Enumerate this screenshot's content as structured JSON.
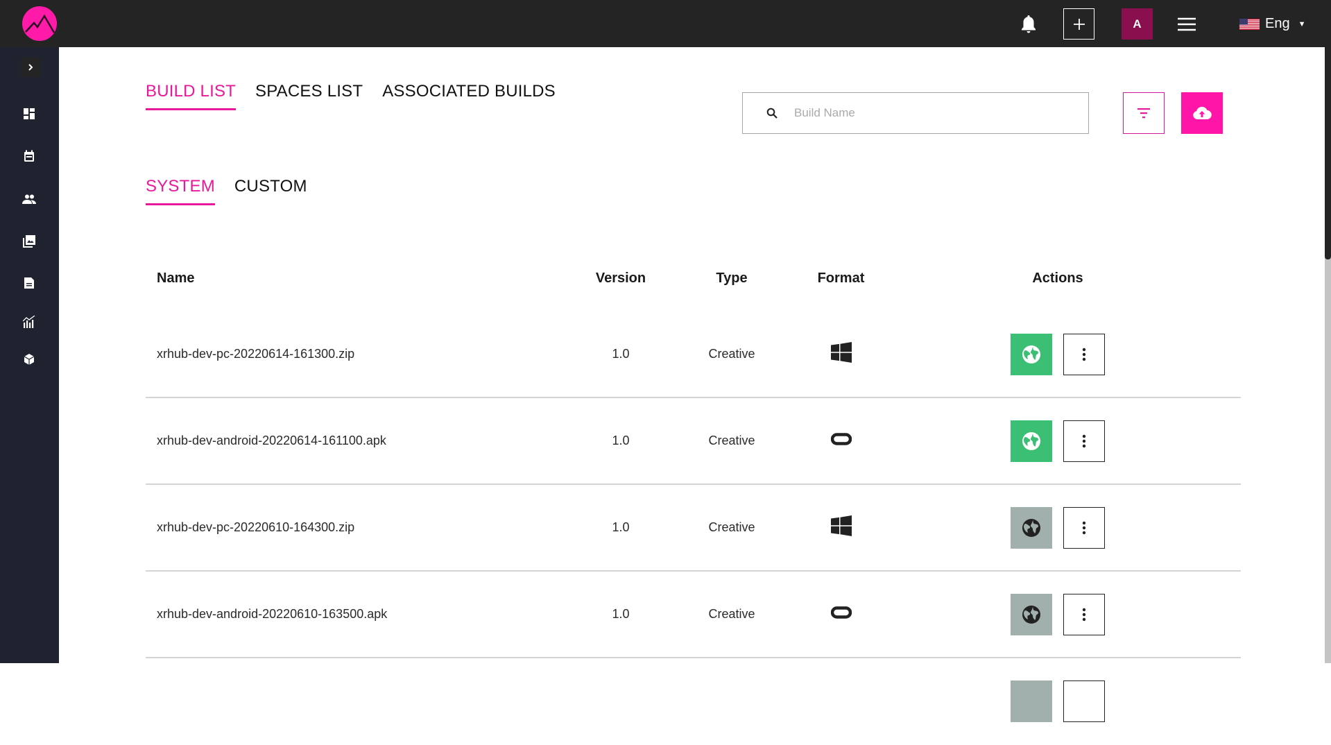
{
  "header": {
    "logo_label": "App logo",
    "notifications_icon": "bell-icon",
    "add_icon": "plus-icon",
    "avatar_initial": "A",
    "menu_icon": "hamburger-icon",
    "language": "Eng",
    "language_flag": "us-flag-icon"
  },
  "sidebar": {
    "toggle_icon": "chevron-right-icon",
    "items": [
      {
        "name": "dashboard",
        "icon": "dashboard-icon"
      },
      {
        "name": "calendar",
        "icon": "calendar-icon"
      },
      {
        "name": "users",
        "icon": "users-icon"
      },
      {
        "name": "gallery",
        "icon": "gallery-icon"
      },
      {
        "name": "documents",
        "icon": "document-icon"
      },
      {
        "name": "analytics",
        "icon": "analytics-icon"
      },
      {
        "name": "builds",
        "icon": "cube-icon"
      }
    ]
  },
  "main": {
    "tabs": [
      {
        "label": "BUILD LIST",
        "active": true
      },
      {
        "label": "SPACES LIST",
        "active": false
      },
      {
        "label": "ASSOCIATED BUILDS",
        "active": false
      }
    ],
    "search": {
      "placeholder": "Build Name",
      "value": ""
    },
    "filter_icon": "filter-icon",
    "upload_icon": "cloud-upload-icon",
    "sub_tabs": [
      {
        "label": "SYSTEM",
        "active": true
      },
      {
        "label": "CUSTOM",
        "active": false
      }
    ],
    "table": {
      "columns": [
        "Name",
        "Version",
        "Type",
        "Format",
        "Actions"
      ],
      "rows": [
        {
          "name": "xrhub-dev-pc-20220614-161300.zip",
          "version": "1.0",
          "type": "Creative",
          "format": "windows",
          "published": true
        },
        {
          "name": "xrhub-dev-android-20220614-161100.apk",
          "version": "1.0",
          "type": "Creative",
          "format": "oculus",
          "published": true
        },
        {
          "name": "xrhub-dev-pc-20220610-164300.zip",
          "version": "1.0",
          "type": "Creative",
          "format": "windows",
          "published": false
        },
        {
          "name": "xrhub-dev-android-20220610-163500.apk",
          "version": "1.0",
          "type": "Creative",
          "format": "oculus",
          "published": false
        },
        {
          "name": "",
          "version": "",
          "type": "",
          "format": "",
          "published": false
        }
      ]
    }
  },
  "colors": {
    "accent": "#e8189b",
    "upload_bg": "#ff16a8",
    "published": "#3bbf74",
    "unpublished": "#a2b0ad",
    "topbar": "#242424",
    "sidebar": "#1f2330",
    "avatar": "#8a0f4f"
  }
}
